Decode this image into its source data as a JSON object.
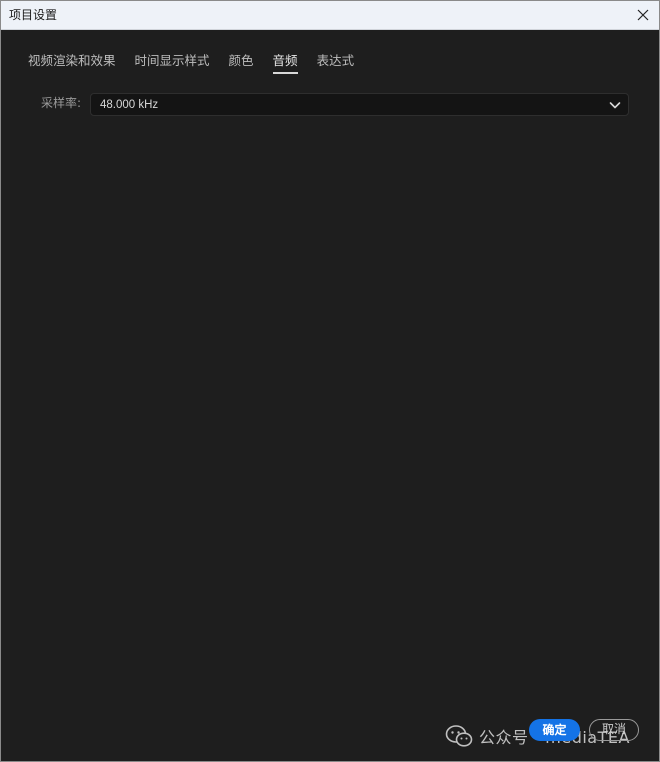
{
  "window": {
    "title": "项目设置"
  },
  "tabs": [
    {
      "label": "视频渲染和效果"
    },
    {
      "label": "时间显示样式"
    },
    {
      "label": "颜色"
    },
    {
      "label": "音频",
      "active": true
    },
    {
      "label": "表达式"
    }
  ],
  "audio": {
    "sample_rate_label": "采样率:",
    "sample_rate_value": "48.000 kHz"
  },
  "footer": {
    "ok_label": "确定",
    "cancel_label": "取消"
  },
  "watermark": {
    "text": "公众号 · mediaTEA",
    "icon": "wechat-icon"
  },
  "colors": {
    "background": "#1e1e1e",
    "titlebar": "#eef2f8",
    "accent": "#1473e6"
  }
}
